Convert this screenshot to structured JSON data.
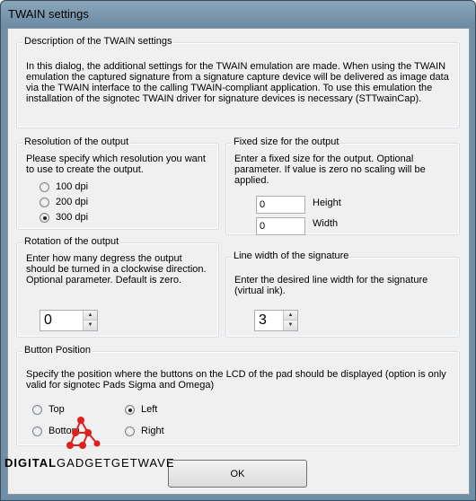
{
  "window": {
    "title": "TWAIN settings"
  },
  "description": {
    "legend": "Description of the TWAIN settings",
    "text": "In this dialog, the additional settings for the TWAIN emulation are made. When using the TWAIN emulation the captured signature from a signature capture device will be delivered as image data via the TWAIN interface to the calling TWAIN-compliant application. To use this emulation the installation of the signotec TWAIN driver for signature devices is necessary (STTwainCap)."
  },
  "resolution": {
    "legend": "Resolution of the output",
    "text": "Please specify which resolution you want to use to create the output.",
    "options": [
      {
        "label": "100 dpi",
        "checked": false
      },
      {
        "label": "200 dpi",
        "checked": false
      },
      {
        "label": "300 dpi",
        "checked": true
      }
    ]
  },
  "fixed_size": {
    "legend": "Fixed size for the output",
    "text": "Enter a fixed size for the output. Optional parameter. If value is zero no scaling will be applied.",
    "height_value": "0",
    "height_label": "Height",
    "width_value": "0",
    "width_label": "Width"
  },
  "rotation": {
    "legend": "Rotation of the output",
    "text": "Enter how many degress the output should be turned in a clockwise direction. Optional parameter. Default is zero.",
    "value": "0"
  },
  "line_width": {
    "legend": "Line width of the signature",
    "text": "Enter the desired line width for the signature (virtual ink).",
    "value": "3"
  },
  "button_position": {
    "legend": "Button Position",
    "text": "Specify the position where the buttons on the LCD of the pad should be displayed (option is only valid for signotec Pads Sigma and Omega)",
    "options": [
      {
        "label": "Top",
        "checked": false
      },
      {
        "label": "Left",
        "checked": true
      },
      {
        "label": "Bottom",
        "checked": false
      },
      {
        "label": "Right",
        "checked": false
      }
    ]
  },
  "ok_button": {
    "label": "OK"
  },
  "watermark": {
    "part1": "DIGITAL",
    "part2": "GADGETGETWAVE"
  },
  "colors": {
    "titlebar": "#6f8fa8",
    "dialog_bg": "#f0f0f0",
    "watermark_red": "#e02020"
  }
}
